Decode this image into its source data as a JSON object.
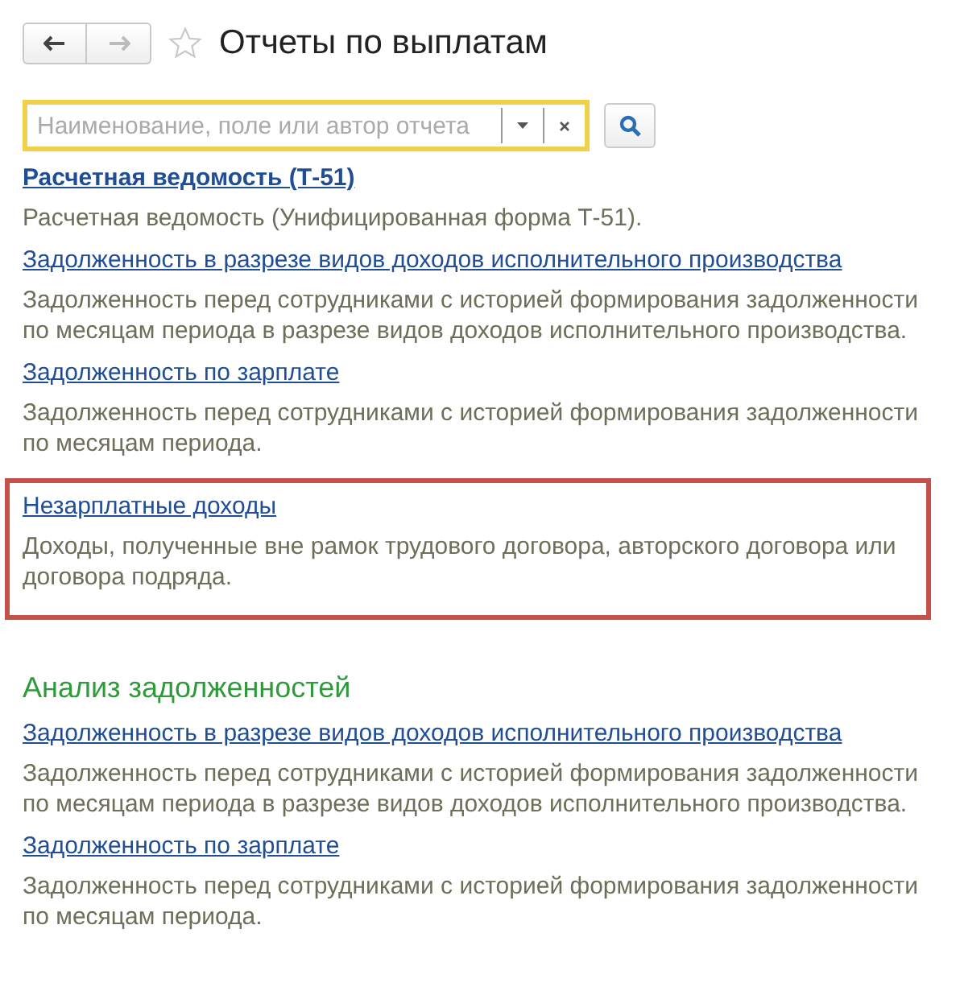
{
  "header": {
    "title": "Отчеты по выплатам",
    "back_disabled": false,
    "forward_disabled": true,
    "favorite": false
  },
  "search": {
    "placeholder": "Наименование, поле или автор отчета"
  },
  "sections": [
    {
      "reports": [
        {
          "title": "Расчетная ведомость (Т-51)",
          "bold": true,
          "highlighted": false,
          "description": "Расчетная ведомость (Унифицированная форма Т-51)."
        },
        {
          "title": "Задолженность в разрезе видов доходов исполнительного производства",
          "bold": false,
          "highlighted": false,
          "description": "Задолженность перед сотрудниками с историей формирования задолженности по месяцам периода в разрезе видов доходов исполнительного производства."
        },
        {
          "title": "Задолженность по зарплате",
          "bold": false,
          "highlighted": false,
          "description": "Задолженность перед сотрудниками с историей формирования задолженности по месяцам периода."
        },
        {
          "title": "Незарплатные доходы",
          "bold": false,
          "highlighted": true,
          "description": "Доходы, полученные вне рамок трудового договора, авторского договора или договора подряда."
        }
      ]
    },
    {
      "heading": "Анализ задолженностей",
      "reports": [
        {
          "title": "Задолженность в разрезе видов доходов исполнительного производства",
          "bold": false,
          "highlighted": false,
          "description": "Задолженность перед сотрудниками с историей формирования задолженности по месяцам периода в разрезе видов доходов исполнительного производства."
        },
        {
          "title": "Задолженность по зарплате",
          "bold": false,
          "highlighted": false,
          "description": "Задолженность перед сотрудниками с историей формирования задолженности по месяцам периода."
        }
      ]
    }
  ]
}
